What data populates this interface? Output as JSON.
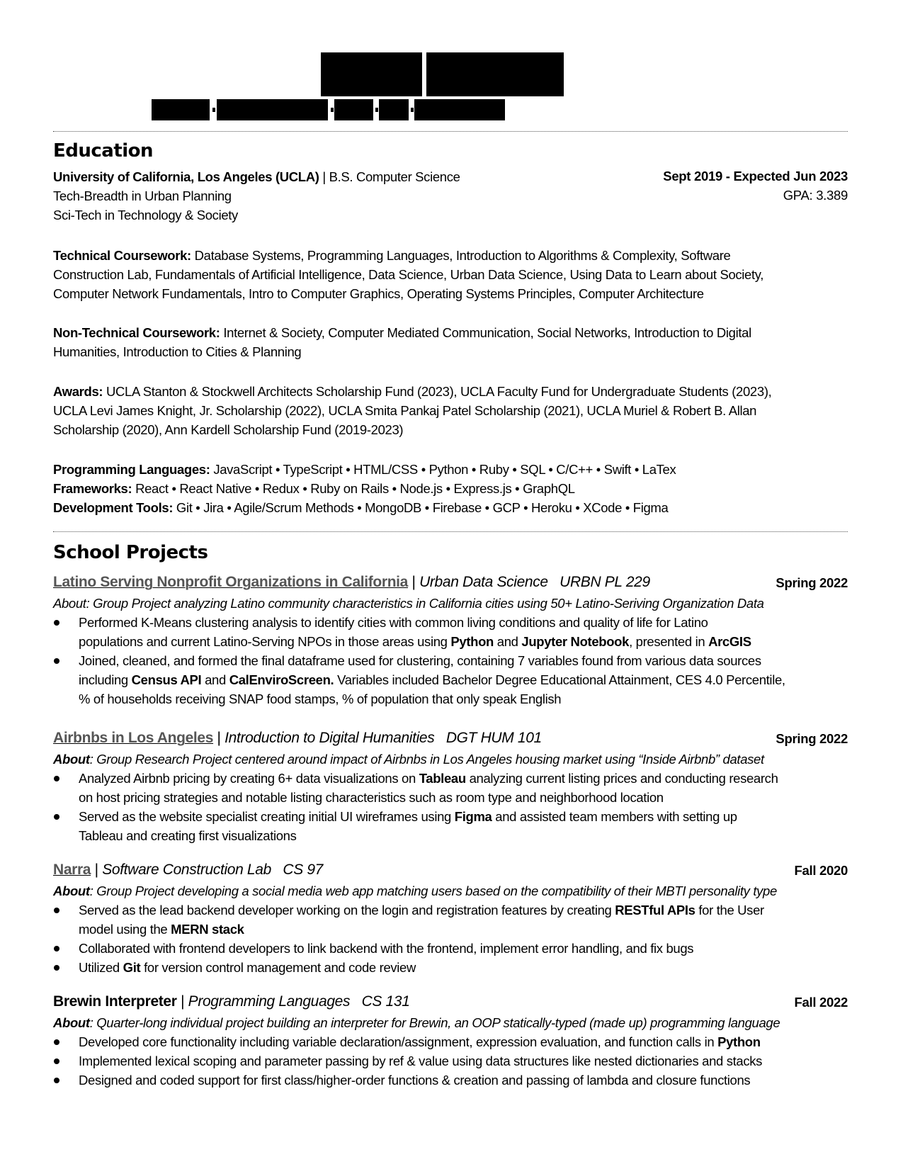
{
  "header": {
    "name_redacted": true,
    "contact_redacted": true
  },
  "education": {
    "title": "Education",
    "school": "University of California, Los Angeles (UCLA)",
    "pipe": " | ",
    "degree": "B.S. Computer Science",
    "dates": "Sept 2019 - Expected Jun 2023",
    "minor1": "Tech-Breadth in Urban Planning",
    "gpa": "GPA: 3.389",
    "minor2": "Sci-Tech in Technology & Society",
    "technical_label": "Technical Coursework:",
    "technical_lines": [
      " Database Systems, Programming Languages, Introduction to Algorithms & Complexity, Software",
      "Construction Lab, Fundamentals of Artificial Intelligence, Data Science, Urban Data Science, Using Data to Learn about Society,",
      "Computer Network Fundamentals, Intro to Computer Graphics, Operating Systems Principles, Computer Architecture"
    ],
    "nontech_label": "Non-Technical Coursework:",
    "nontech_lines": [
      " Internet & Society, Computer Mediated Communication, Social Networks, Introduction to Digital",
      "Humanities, Introduction to Cities & Planning"
    ],
    "awards_label": "Awards:",
    "awards_lines": [
      " UCLA Stanton & Stockwell Architects Scholarship Fund (2023), UCLA Faculty Fund for Undergraduate Students (2023),",
      "UCLA Levi James Knight, Jr. Scholarship (2022), UCLA Smita Pankaj Patel Scholarship (2021), UCLA Muriel & Robert B. Allan",
      "Scholarship (2020), Ann Kardell Scholarship Fund (2019-2023)"
    ],
    "prog_label": "Programming Languages:",
    "prog_value": " JavaScript • TypeScript • HTML/CSS • Python • Ruby • SQL • C/C++ • Swift • LaTex",
    "frameworks_label": "Frameworks:",
    "frameworks_value": " React • React Native • Redux • Ruby on Rails • Node.js • Express.js  • GraphQL",
    "tools_label": "Development Tools:",
    "tools_value": " Git • Jira • Agile/Scrum Methods • MongoDB • Firebase  • GCP • Heroku • XCode • Figma"
  },
  "projects": {
    "title": "School Projects",
    "items": [
      {
        "name": "Latino Serving Nonprofit Organizations in California",
        "course": "Urban Data Science   URBN PL 229",
        "term": "Spring 2022",
        "about_label": "About:",
        "about": " Group Project analyzing Latino community characteristics in California cities using 50+ Latino-Seriving Organization Data",
        "bullets": [
          [
            "Performed K-Means clustering analysis to identify cities with common living conditions and quality of life for Latino"
          ],
          [
            "populations and current Latino-Serving NPOs in those areas using ",
            "Python",
            " and ",
            "Jupyter Notebook",
            ", presented in ",
            "ArcGIS"
          ],
          [
            "Joined, cleaned, and formed the final dataframe used for clustering, containing 7 variables found from various data sources"
          ],
          [
            "including ",
            "Census API",
            " and ",
            "CalEnviroScreen.",
            " Variables included Bachelor Degree Educational Attainment, CES 4.0 Percentile,"
          ],
          [
            "% of households receiving SNAP food stamps, % of population that only speak English"
          ]
        ]
      },
      {
        "name": "Airbnbs in Los Angeles",
        "course": "Introduction to Digital Humanities   DGT HUM 101",
        "term": "Spring 2022",
        "about_label": "About",
        "about": ": Group Research Project centered around impact of Airbnbs in Los Angeles housing market using “Inside Airbnb” dataset",
        "bullets": [
          [
            "Analyzed Airbnb pricing by creating 6+ data visualizations on ",
            "Tableau",
            " analyzing current listing prices and conducting research"
          ],
          [
            "on host pricing strategies and notable listing characteristics such as room type and neighborhood location"
          ],
          [
            "Served as the website specialist creating initial UI wireframes using ",
            "Figma",
            " and assisted team members with setting up"
          ],
          [
            "Tableau and creating first visualizations"
          ]
        ]
      },
      {
        "name": "Narra",
        "course": "Software Construction Lab   CS 97",
        "term": "Fall 2020",
        "about_label": "About",
        "about": ": Group Project developing a social media web app matching users based on the compatibility of their MBTI personality type",
        "bullets": [
          [
            "Served as the lead backend developer working on the login and registration features by creating ",
            "RESTful APIs",
            " for the User"
          ],
          [
            "model using the ",
            "MERN stack"
          ],
          [
            "Collaborated with frontend developers to link backend with the frontend, implement error handling, and fix bugs"
          ],
          [
            "Utilized ",
            "Git",
            " for version control management and code review"
          ]
        ]
      },
      {
        "name": "Brewin Interpreter",
        "course": "Programming Languages   CS 131",
        "term": "Fall 2022",
        "about_label": "About",
        "about": ": Quarter-long individual project building an interpreter for Brewin, an OOP statically-typed (made up) programming language",
        "bullets": [
          [
            "Developed core functionality including variable declaration/assignment, expression evaluation, and function calls in ",
            "Python"
          ],
          [
            "Implemented lexical scoping and parameter passing by ref  & value using data structures like nested dictionaries and stacks"
          ],
          [
            "Designed and coded support for first class/higher-order functions & creation and passing of lambda and closure functions"
          ]
        ]
      }
    ]
  }
}
